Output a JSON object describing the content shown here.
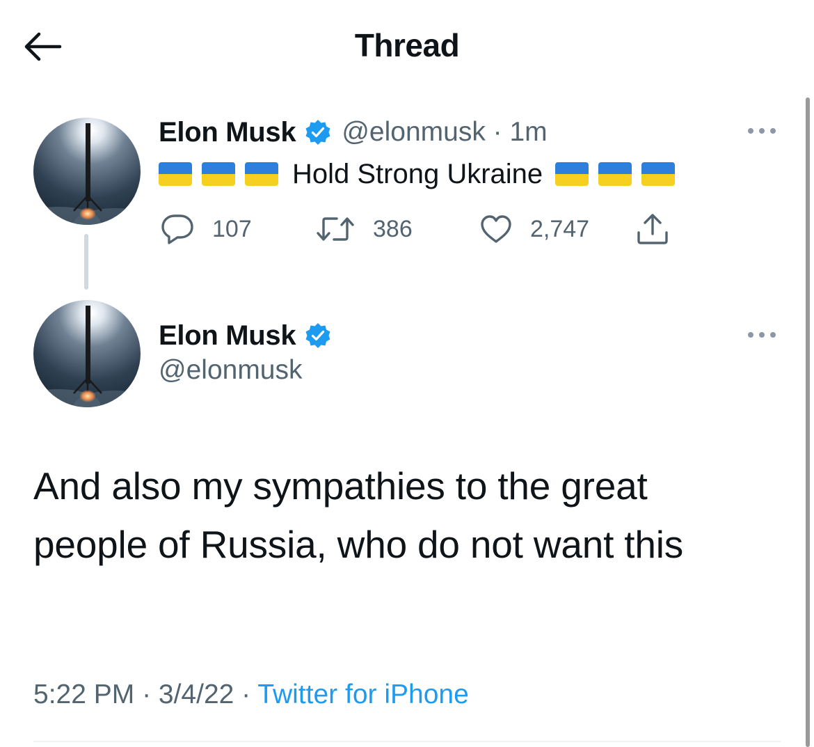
{
  "header": {
    "title": "Thread",
    "back_icon": "arrow-left-icon"
  },
  "colors": {
    "accent": "#1d9bf0",
    "secondary_text": "#536471",
    "verified": "#1d9bf0",
    "flag_blue": "#2d7fdb",
    "flag_yellow": "#f5d020"
  },
  "tweet1": {
    "name": "Elon Musk",
    "handle_meta": "@elonmusk · 1m",
    "flags_before": [
      "ukraine-flag",
      "ukraine-flag",
      "ukraine-flag"
    ],
    "text": "Hold Strong Ukraine",
    "flags_after": [
      "ukraine-flag",
      "ukraine-flag",
      "ukraine-flag"
    ],
    "replies": "107",
    "retweets": "386",
    "likes": "2,747"
  },
  "tweet2": {
    "name": "Elon Musk",
    "handle": "@elonmusk",
    "body": "And also my sympathies to the great people of Russia, who do not want this",
    "time": "5:22 PM · 3/4/22 · ",
    "source": "Twitter for iPhone"
  }
}
